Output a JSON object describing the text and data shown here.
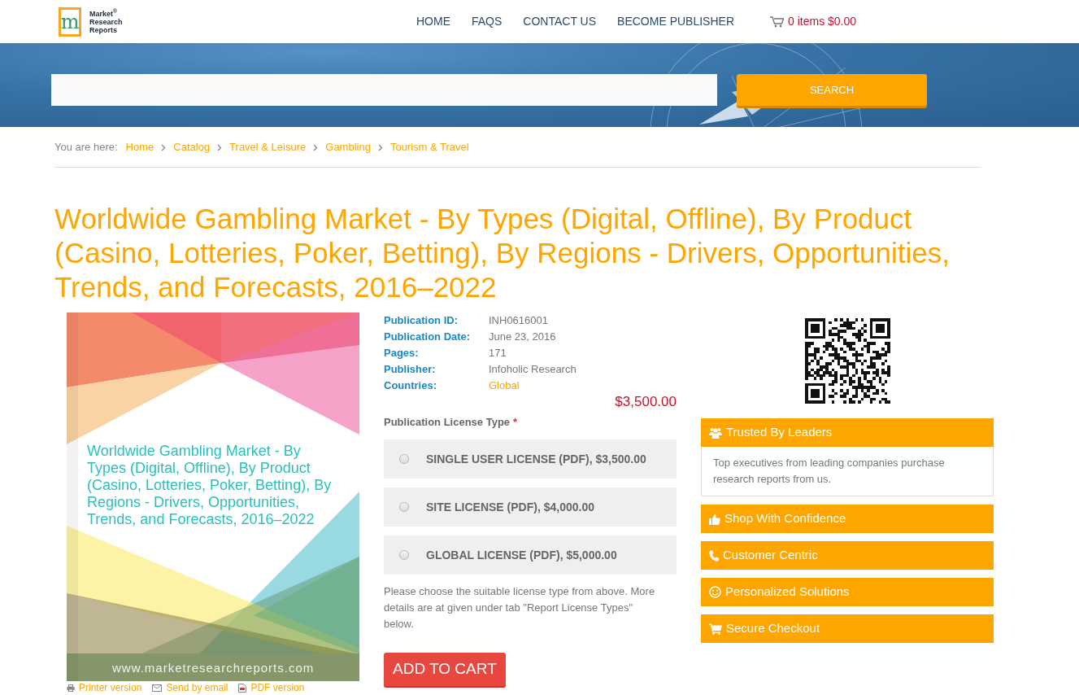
{
  "header": {
    "logo": {
      "mark": "m",
      "lines": [
        "Market$^{®}$",
        "Research",
        "Reports"
      ]
    },
    "nav": [
      {
        "label": "HOME"
      },
      {
        "label": "FAQS"
      },
      {
        "label": "CONTACT US"
      },
      {
        "label": "BECOME PUBLISHER"
      }
    ],
    "cart": "0 items $0.00"
  },
  "search": {
    "button": "SEARCH"
  },
  "breadcrumb": {
    "prefix": "You are here:",
    "items": [
      "Home",
      "Catalog",
      "Travel & Leisure",
      "Gambling",
      "Tourism & Travel"
    ]
  },
  "title": "Worldwide Gambling Market - By Types (Digital, Offline), By Product (Casino, Lotteries, Poker, Betting), By Regions - Drivers, Opportunities, Trends, and Forecasts, 2016–2022",
  "cover": {
    "title": "Worldwide Gambling Market - By Types (Digital, Offline), By Product (Casino, Lotteries, Poker, Betting), By Regions - Drivers, Opportunities, Trends, and Forecasts, 2016–2022",
    "url": "www.marketresearchreports.com",
    "links": [
      "Printer version",
      "Send by email",
      "PDF version"
    ]
  },
  "details": [
    {
      "label": "Publication ID:",
      "value": "INH0616001",
      "kind": "text"
    },
    {
      "label": "Publication Date:",
      "value": "June 23, 2016",
      "kind": "text"
    },
    {
      "label": "Pages:",
      "value": "171",
      "kind": "text"
    },
    {
      "label": "Publisher:",
      "value": "Infoholic Research",
      "kind": "text"
    },
    {
      "label": "Countries:",
      "value": "Global",
      "kind": "link"
    }
  ],
  "price": "$3,500.00",
  "license": {
    "heading": "Publication License Type",
    "required_mark": "*",
    "options": [
      {
        "label": "SINGLE USER LICENSE (PDF), $3,500.00",
        "selected": false
      },
      {
        "label": "SITE LICENSE (PDF), $4,000.00",
        "selected": false
      },
      {
        "label": "GLOBAL LICENSE (PDF), $5,000.00",
        "selected": false
      }
    ],
    "note": "Please choose the suitable license type from above. More details are at given under tab \"Report License Types\" below."
  },
  "add_to_cart": "ADD TO CART",
  "features": [
    {
      "label": "Trusted By Leaders",
      "body": "Top executives from leading companies purchase research reports from us."
    },
    {
      "label": "Shop With Confidence"
    },
    {
      "label": "Customer Centric"
    },
    {
      "label": "Personalized Solutions"
    },
    {
      "label": "Secure Checkout"
    }
  ]
}
